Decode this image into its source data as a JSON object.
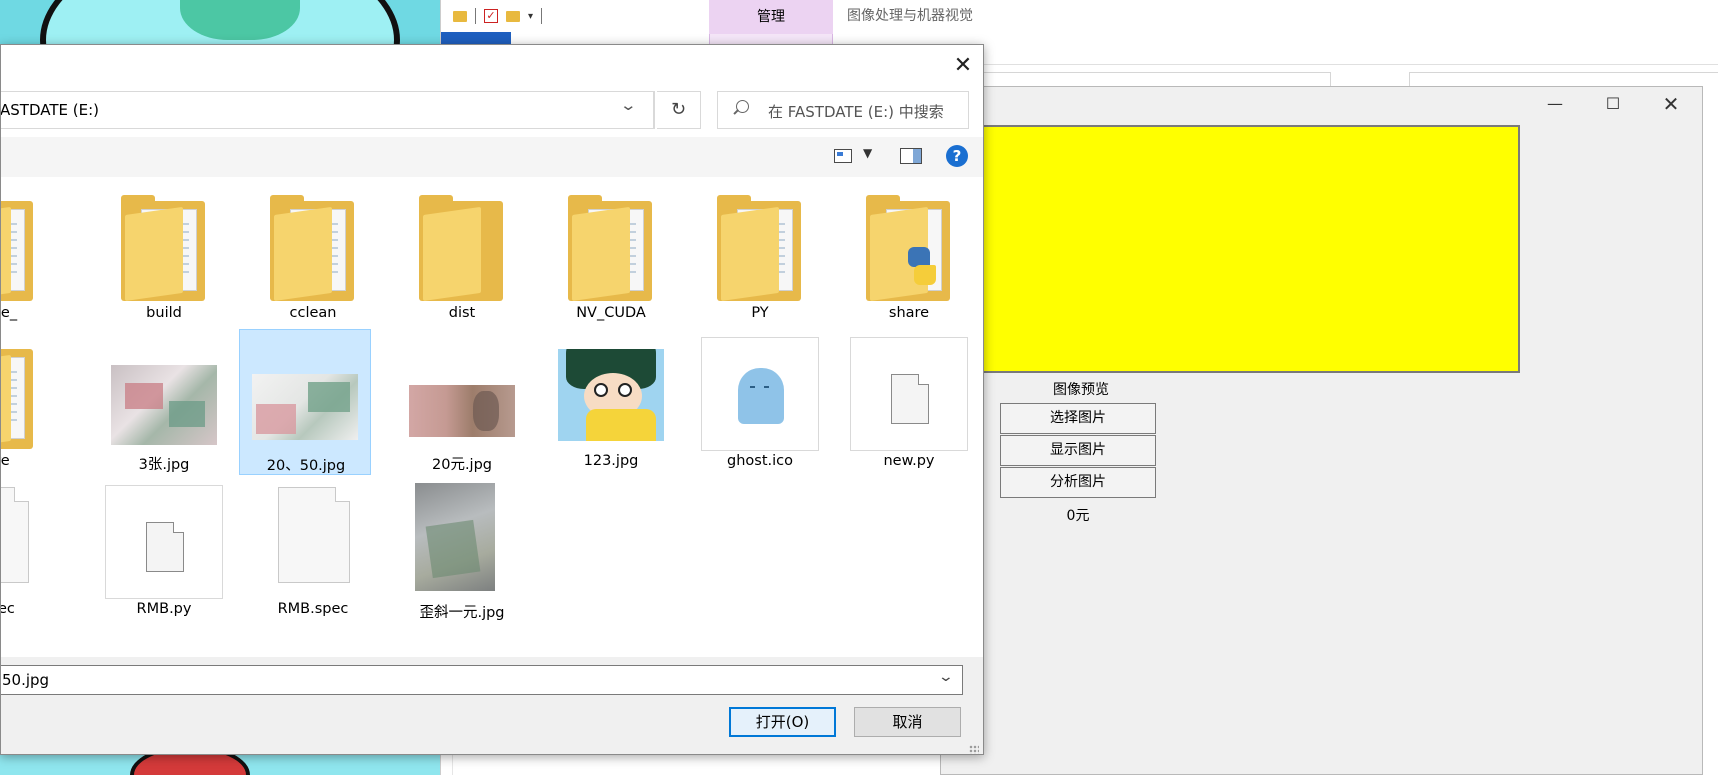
{
  "explorer": {
    "management_tab": "管理",
    "window_title": "图像处理与机器视觉"
  },
  "app": {
    "min_icon": "—",
    "max_icon": "☐",
    "close_icon": "✕",
    "preview_label": "图像预览",
    "select_button": "选择图片",
    "show_button": "显示图片",
    "analyze_button": "分析图片",
    "result": "0元",
    "preview_color": "#ffff00"
  },
  "dialog": {
    "close_icon": "✕",
    "address": "ASTDATE (E:)",
    "refresh_icon": "↻",
    "search_placeholder": "在 FASTDATE (E:) 中搜索",
    "help_icon": "?",
    "items": [
      {
        "label": "cache_",
        "kind": "folder-docs"
      },
      {
        "label": "build",
        "kind": "folder-docs"
      },
      {
        "label": "cclean",
        "kind": "folder-docs"
      },
      {
        "label": "dist",
        "kind": "folder-plain"
      },
      {
        "label": "NV_CUDA",
        "kind": "folder-docs"
      },
      {
        "label": "PY",
        "kind": "folder-docs"
      },
      {
        "label": "share",
        "kind": "folder-python"
      },
      {
        "label": "ware",
        "kind": "folder-docs"
      },
      {
        "label": "3张.jpg",
        "kind": "image"
      },
      {
        "label": "20、50.jpg",
        "kind": "image",
        "selected": true
      },
      {
        "label": "20元.jpg",
        "kind": "image"
      },
      {
        "label": "123.jpg",
        "kind": "image"
      },
      {
        "label": "ghost.ico",
        "kind": "icon"
      },
      {
        "label": "new.py",
        "kind": "script"
      },
      {
        "label": "v.spec",
        "kind": "file"
      },
      {
        "label": "RMB.py",
        "kind": "script"
      },
      {
        "label": "RMB.spec",
        "kind": "file"
      },
      {
        "label": "歪斜一元.jpg",
        "kind": "image"
      }
    ],
    "filename_value": "50.jpg",
    "open_button": "打开(O)",
    "cancel_button": "取消",
    "selection_color": "#cce8ff",
    "accent_color": "#0078d7"
  }
}
